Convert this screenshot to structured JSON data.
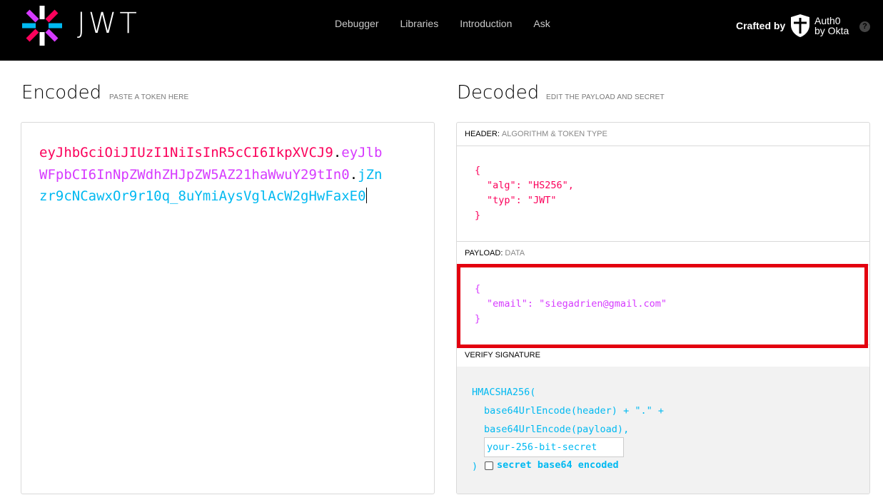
{
  "header": {
    "logo_text": "JWT",
    "nav": [
      "Debugger",
      "Libraries",
      "Introduction",
      "Ask"
    ],
    "crafted_by": "Crafted by",
    "auth0_line1": "Auth0",
    "auth0_line2": "by Okta",
    "help": "?"
  },
  "encoded": {
    "title": "Encoded",
    "subtitle": "PASTE A TOKEN HERE",
    "token_header": "eyJhbGciOiJIUzI1NiIsInR5cCI6IkpXVCJ9",
    "token_payload": "eyJlbWFpbCI6InNpZWdhZHJpZW5AZ21haWwuY29tIn0",
    "token_signature": "jZnzr9cNCawxOr9r10q_8uYmiAysVglAcW2gHwFaxE0",
    "dot": "."
  },
  "decoded": {
    "title": "Decoded",
    "subtitle": "EDIT THE PAYLOAD AND SECRET",
    "header_label": "HEADER:",
    "header_sublabel": "ALGORITHM & TOKEN TYPE",
    "header_lines": [
      "{",
      "\"alg\": \"HS256\",",
      "\"typ\": \"JWT\"",
      "}"
    ],
    "payload_label": "PAYLOAD:",
    "payload_sublabel": "DATA",
    "payload_lines": [
      "{",
      "\"email\": \"siegadrien@gmail.com\"",
      "}"
    ],
    "verify_label": "VERIFY SIGNATURE",
    "verify_lines": [
      "HMACSHA256(",
      "base64UrlEncode(header) + \".\" +",
      "base64UrlEncode(payload),"
    ],
    "secret_placeholder": "your-256-bit-secret",
    "close_paren": ")",
    "checkbox_label": "secret base64 encoded",
    "checkbox_checked": false
  },
  "colors": {
    "header_part": "#fb015b",
    "payload_part": "#d63aff",
    "signature_part": "#00b9f1",
    "highlight": "#e3000f"
  }
}
